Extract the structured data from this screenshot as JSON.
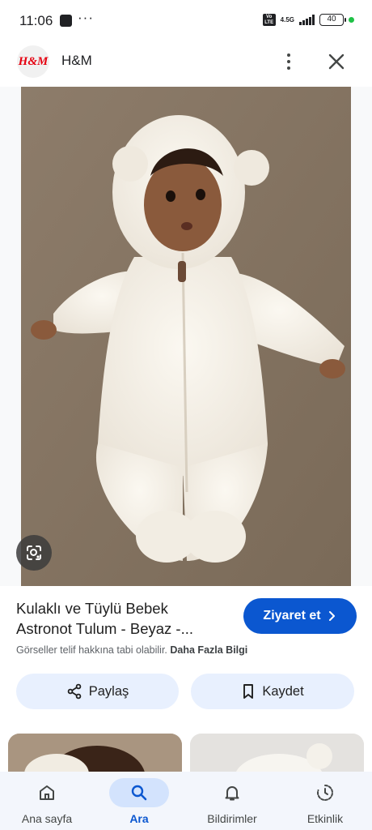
{
  "status_bar": {
    "time": "11:06",
    "dots": "···",
    "volte_label": "Vo LTE",
    "network": "4.5G",
    "battery": "40"
  },
  "header": {
    "logo_text": "H&M",
    "site_name": "H&M"
  },
  "result": {
    "title_line1": "Kulaklı ve Tüylü Bebek",
    "title_line2": "Astronot Tulum - Beyaz -...",
    "visit_label": "Ziyaret et",
    "copyright_text": "Görseller telif hakkına tabi olabilir.",
    "more_info_label": "Daha Fazla Bilgi",
    "share_label": "Paylaş",
    "save_label": "Kaydet"
  },
  "bottom_nav": {
    "items": [
      {
        "label": "Ana sayfa",
        "icon": "home-icon",
        "active": false
      },
      {
        "label": "Ara",
        "icon": "search-icon",
        "active": true
      },
      {
        "label": "Bildirimler",
        "icon": "bell-icon",
        "active": false
      },
      {
        "label": "Etkinlik",
        "icon": "activity-icon",
        "active": false
      }
    ]
  },
  "colors": {
    "accent": "#0b57d0",
    "chip_bg": "#e8f0fe",
    "nav_bg": "#f3f6fc",
    "brand_red": "#e50010"
  }
}
